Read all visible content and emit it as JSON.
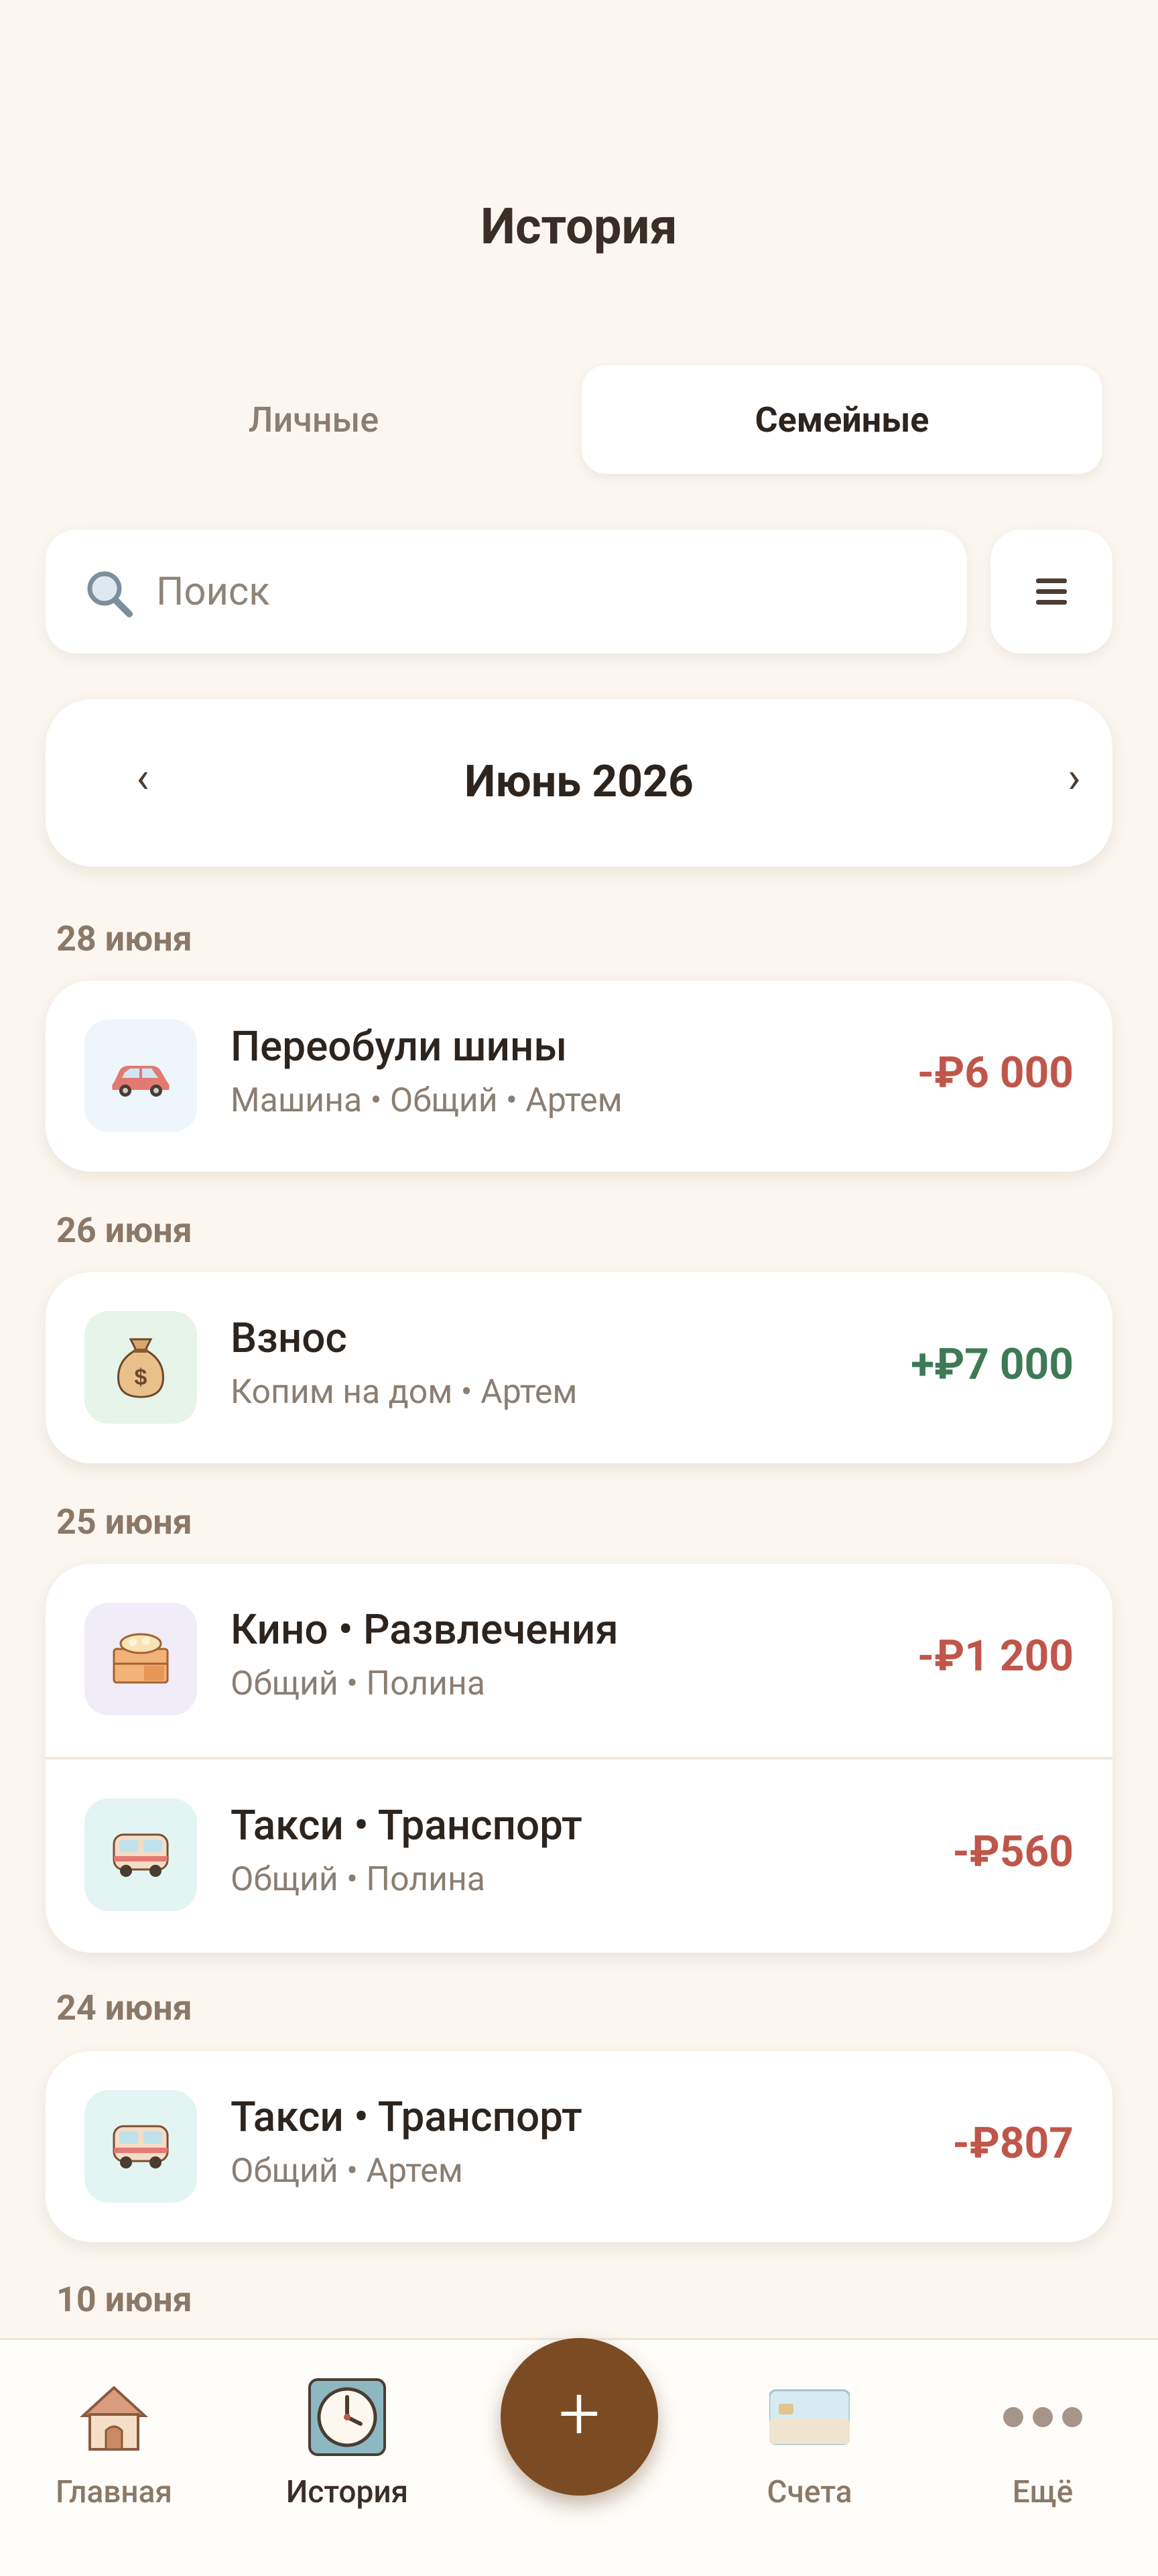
{
  "header": {
    "title": "История"
  },
  "tabs": {
    "personal": "Личные",
    "family": "Семейные",
    "active": "family"
  },
  "search": {
    "placeholder": "Поиск"
  },
  "month_selector": {
    "label": "Июнь 2026",
    "prev": "‹",
    "next": "›"
  },
  "groups": [
    {
      "date": "28 июня",
      "items": [
        {
          "title": "Переобули шины",
          "subtitle": "Машина • Общий •  Артем",
          "amount": "-₽6 000",
          "type": "expense",
          "icon": "car-icon"
        }
      ]
    },
    {
      "date": "26 июня",
      "items": [
        {
          "title": "Взнос",
          "subtitle": "Копим на дом • Артем",
          "amount": "+₽7 000",
          "type": "income",
          "icon": "money-bag-icon"
        }
      ]
    },
    {
      "date": "25 июня",
      "items": [
        {
          "title": "Кино • Развлечения",
          "subtitle": "Общий • Полина",
          "amount": "-₽1 200",
          "type": "expense",
          "icon": "cinema-icon"
        },
        {
          "title": "Такси • Транспорт",
          "subtitle": "Общий • Полина",
          "amount": "-₽560",
          "type": "expense",
          "icon": "bus-icon"
        }
      ]
    },
    {
      "date": "24 июня",
      "items": [
        {
          "title": "Такси • Транспорт",
          "subtitle": "Общий • Артем",
          "amount": "-₽807",
          "type": "expense",
          "icon": "bus-icon"
        }
      ]
    },
    {
      "date": "10 июня",
      "items": []
    }
  ],
  "bottom_nav": {
    "home": "Главная",
    "history": "История",
    "add": "+",
    "accounts": "Счета",
    "more": "Ещё"
  },
  "colors": {
    "expense": "#c0564a",
    "income": "#3d7a55",
    "fab": "#7b4c24",
    "background": "#fbf7f0"
  }
}
